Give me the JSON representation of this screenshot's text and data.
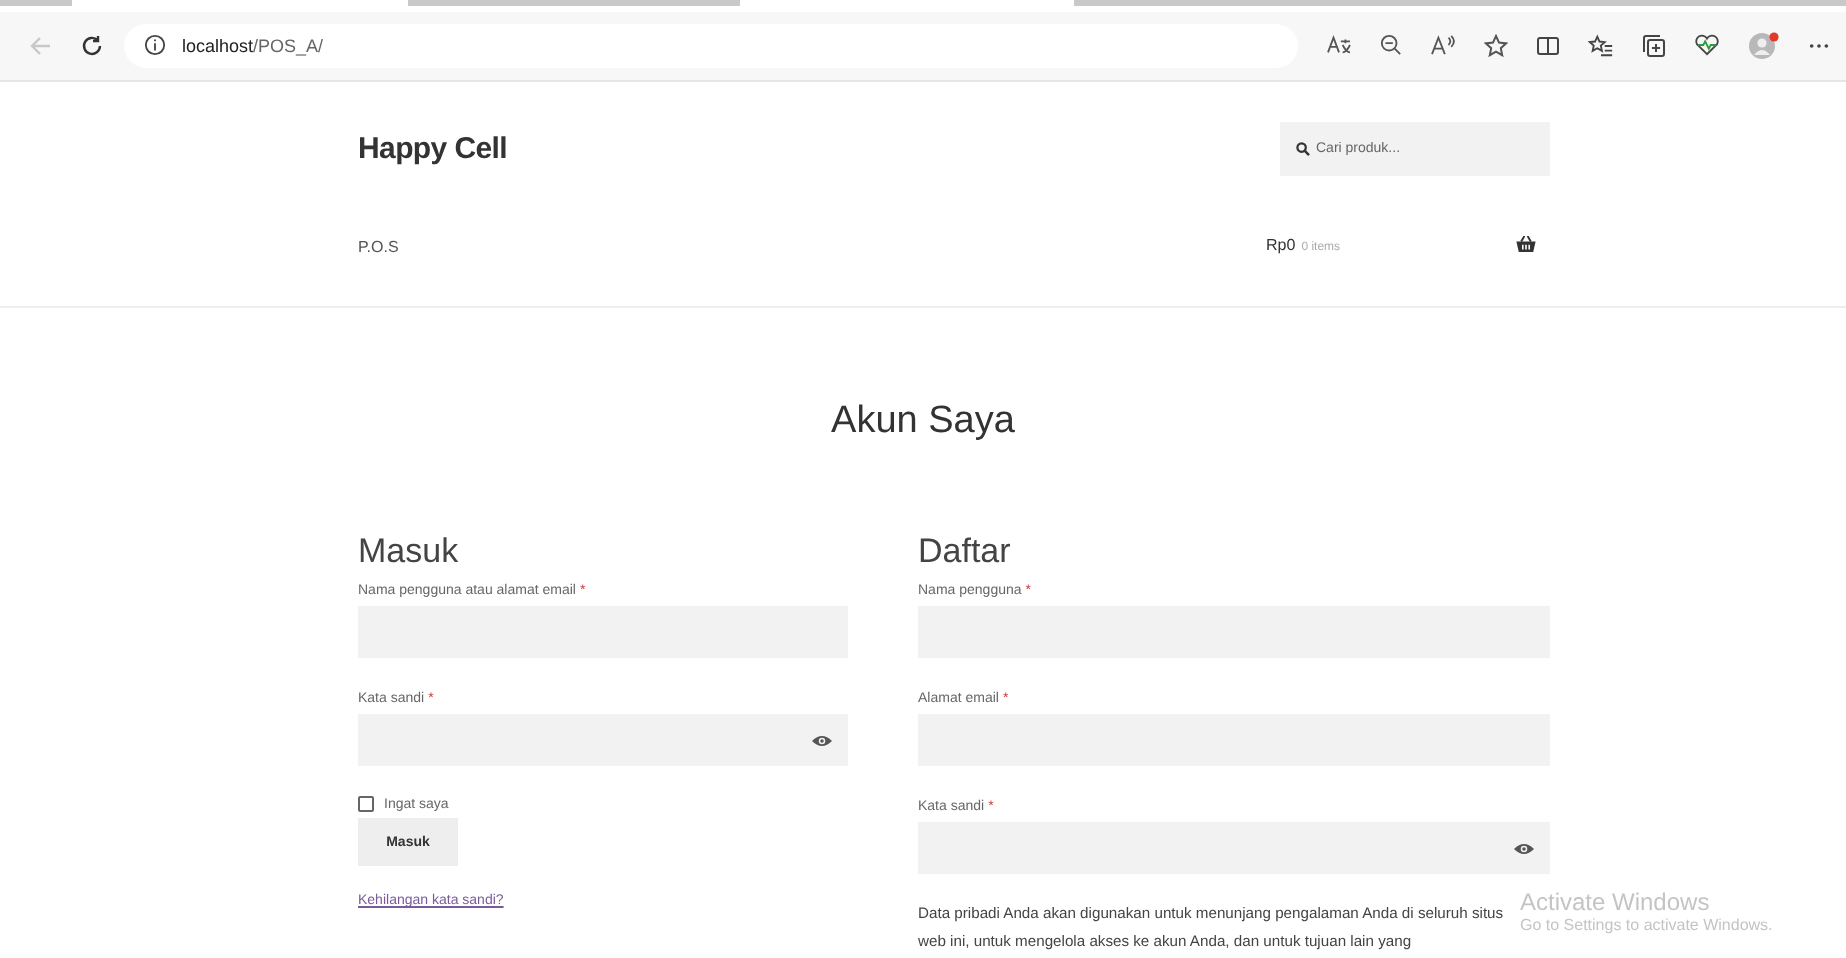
{
  "browser": {
    "url_host": "localhost",
    "url_path": "/POS_A/"
  },
  "header": {
    "site_title": "Happy Cell",
    "search": {
      "placeholder": "Cari produk..."
    },
    "nav": [
      "P.O.S"
    ],
    "cart": {
      "total": "Rp0",
      "count": "0 items"
    }
  },
  "page_title": "Akun Saya",
  "login": {
    "heading": "Masuk",
    "fields": [
      {
        "label": "Nama pengguna atau alamat email",
        "required_mark": "*",
        "kind": "text"
      },
      {
        "label": "Kata sandi",
        "required_mark": "*",
        "kind": "password"
      }
    ],
    "remember": {
      "label": "Ingat saya",
      "checked": false
    },
    "button": "Masuk",
    "lost_password": "Kehilangan kata sandi?"
  },
  "register": {
    "heading": "Daftar",
    "fields": [
      {
        "label": "Nama pengguna",
        "required_mark": "*",
        "kind": "text"
      },
      {
        "label": "Alamat email",
        "required_mark": "*",
        "kind": "text"
      },
      {
        "label": "Kata sandi",
        "required_mark": "*",
        "kind": "password"
      }
    ],
    "privacy_text": "Data pribadi Anda akan digunakan untuk menunjang pengalaman Anda di seluruh situs web ini, untuk mengelola akses ke akun Anda, dan untuk tujuan lain yang"
  },
  "os_overlay": {
    "title": "Activate Windows",
    "subtitle": "Go to Settings to activate Windows."
  }
}
